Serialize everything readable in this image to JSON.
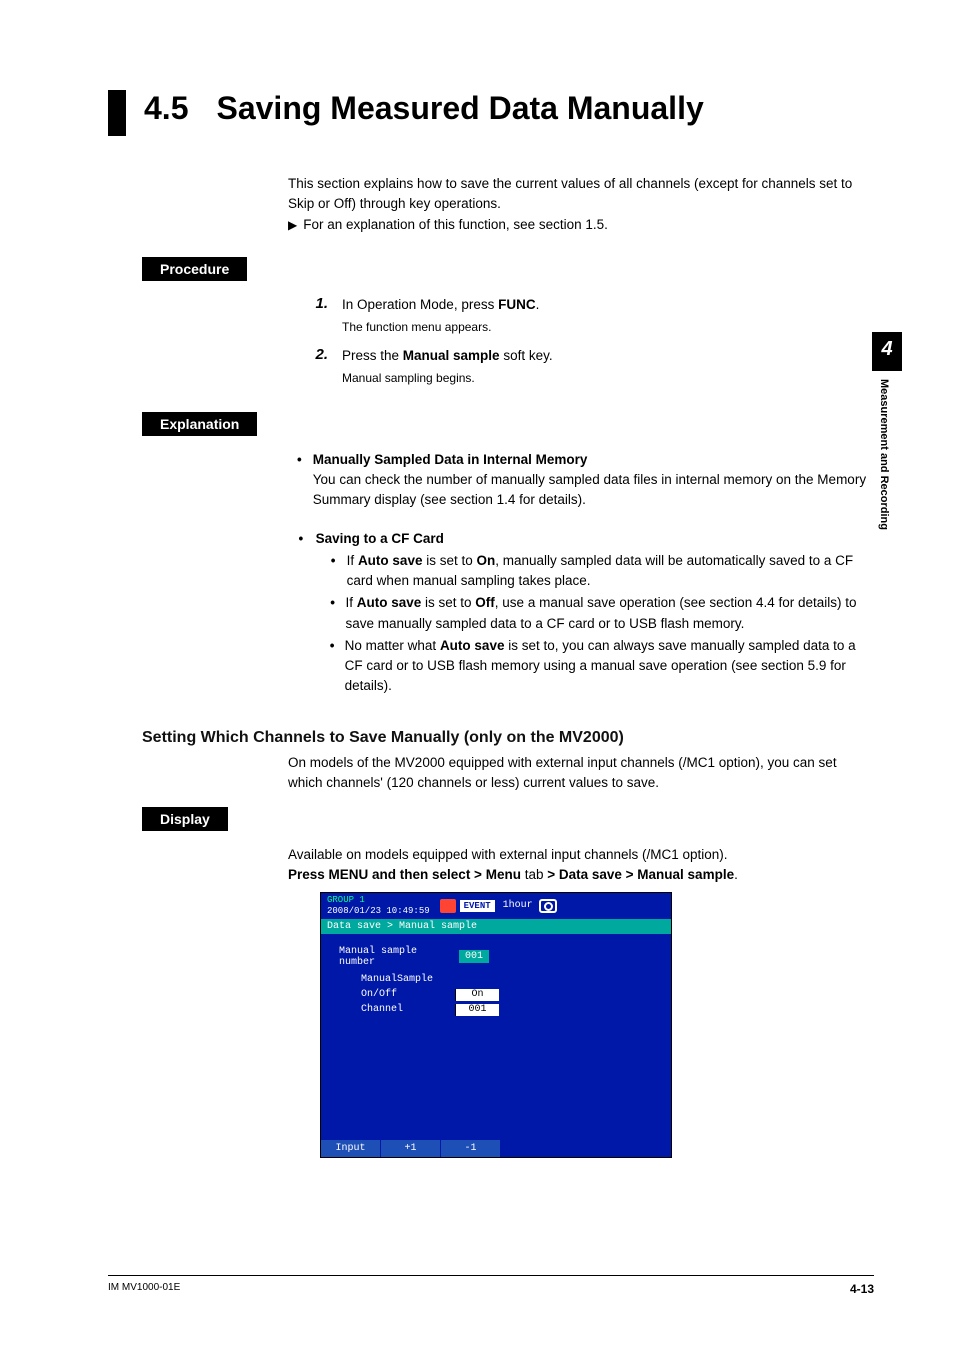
{
  "side": {
    "chapter": "4",
    "vtext": "Measurement and Recording"
  },
  "title": {
    "num": "4.5",
    "text": "Saving Measured Data Manually"
  },
  "intro": {
    "line1": "This section explains how to save the current values of all channels (except for channels set to Skip or Off) through key operations.",
    "line2": "For an explanation of this function, see section 1.5."
  },
  "labels": {
    "procedure": "Procedure",
    "explanation": "Explanation",
    "display": "Display"
  },
  "steps": [
    {
      "num": "1.",
      "main_pre": "In Operation Mode, press ",
      "main_b": "FUNC",
      "main_post": ".",
      "sub": "The function menu appears."
    },
    {
      "num": "2.",
      "main_pre": "Press the ",
      "main_b": "Manual sample",
      "main_post": " soft key.",
      "sub": "Manual sampling begins."
    }
  ],
  "expl": {
    "b1_title": "Manually Sampled Data in Internal Memory",
    "b1_body": "You can check the number of manually sampled data files in internal memory on the Memory Summary display (see section 1.4 for details).",
    "b2_title": "Saving to a CF Card",
    "b2_items": [
      {
        "pre": "If ",
        "b1": "Auto save",
        "mid": " is set to ",
        "b2": "On",
        "post": ", manually sampled data will be automatically saved to a CF card when manual sampling takes place."
      },
      {
        "pre": "If ",
        "b1": "Auto save",
        "mid": " is set to ",
        "b2": "Off",
        "post": ", use a manual save operation (see section 4.4 for details) to save manually sampled data to a CF card or to USB flash memory."
      },
      {
        "pre": "No matter what ",
        "b1": "Auto save",
        "mid": "",
        "b2": "",
        "post": " is set to, you can always save manually sampled data to a CF card or to USB flash memory using a manual save operation (see section 5.9 for details)."
      }
    ]
  },
  "h3": "Setting Which Channels to Save Manually (only on the MV2000)",
  "h3_body": "On models of the MV2000 equipped with external input channels (/MC1 option), you can set which channels' (120 channels or less) current values to save.",
  "disp": {
    "line1": "Available on models equipped with external input channels (/MC1 option).",
    "nav_pre": "Press MENU and then select > Menu",
    "nav_mid": " tab ",
    "nav_post": "> Data save > Manual sample",
    "nav_end": "."
  },
  "shot": {
    "group": "GROUP 1",
    "ts": "2008/01/23 10:49:59",
    "event": "EVENT",
    "hour": "1hour",
    "path": "Data save > Manual sample",
    "row1_label": "Manual sample number",
    "row1_value": "001",
    "grp_title": "ManualSample",
    "f1_label": "On/Off",
    "f1_value": "On",
    "f2_label": "Channel",
    "f2_value": "001",
    "btn1": "Input",
    "btn2": "+1",
    "btn3": "-1"
  },
  "footer": {
    "left": "IM MV1000-01E",
    "right": "4-13"
  },
  "chart_data": null
}
